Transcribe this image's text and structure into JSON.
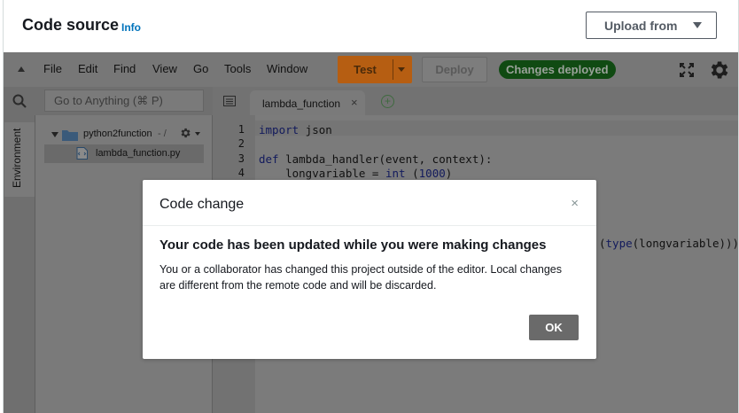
{
  "header": {
    "title": "Code source",
    "info_label": "Info",
    "upload_label": "Upload from"
  },
  "menubar": {
    "items": [
      "File",
      "Edit",
      "Find",
      "View",
      "Go",
      "Tools",
      "Window"
    ],
    "test_label": "Test",
    "deploy_label": "Deploy",
    "status": "Changes deployed"
  },
  "search": {
    "placeholder": "Go to Anything (⌘ P)"
  },
  "sidebar": {
    "environment_label": "Environment",
    "folder": "python2function",
    "folder_suffix": "- /",
    "file": "lambda_function.py"
  },
  "editor": {
    "tab_label": "lambda_function",
    "line_numbers": [
      "1",
      "2",
      "3",
      "4"
    ],
    "lines": [
      {
        "kw": "import",
        "rest": " json"
      },
      {
        "kw": "",
        "rest": ""
      },
      {
        "kw": "def",
        "rest": " lambda_handler(event, context):"
      },
      {
        "pre": "    longvariable = ",
        "builtin": "int",
        "mid": " (",
        "num": "1000",
        "post": ")"
      }
    ],
    "partial_line": {
      "pre": "(",
      "builtin": "type",
      "post": "(longvariable)))"
    }
  },
  "modal": {
    "title": "Code change",
    "heading": "Your code has been updated while you were making changes",
    "body": "You or a collaborator has changed this project outside of the editor. Local changes are different from the remote code and will be discarded.",
    "ok_label": "OK"
  }
}
